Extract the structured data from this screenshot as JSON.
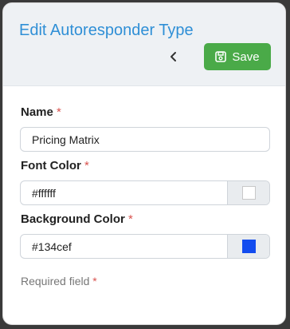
{
  "header": {
    "title": "Edit Autoresponder Type",
    "save_label": "Save"
  },
  "form": {
    "name": {
      "label": "Name",
      "required_mark": "*",
      "value": "Pricing Matrix"
    },
    "font_color": {
      "label": "Font Color",
      "required_mark": "*",
      "value": "#ffffff",
      "swatch": "#ffffff"
    },
    "background_color": {
      "label": "Background Color",
      "required_mark": "*",
      "value": "#134cef",
      "swatch": "#134cef"
    }
  },
  "footer": {
    "note": "Required field",
    "required_mark": "*"
  },
  "colors": {
    "title": "#2f8fd6",
    "save_button": "#4aaa48",
    "required": "#d9534f"
  },
  "icons": {
    "back": "chevron-left-icon",
    "save": "floppy-disk-icon"
  }
}
